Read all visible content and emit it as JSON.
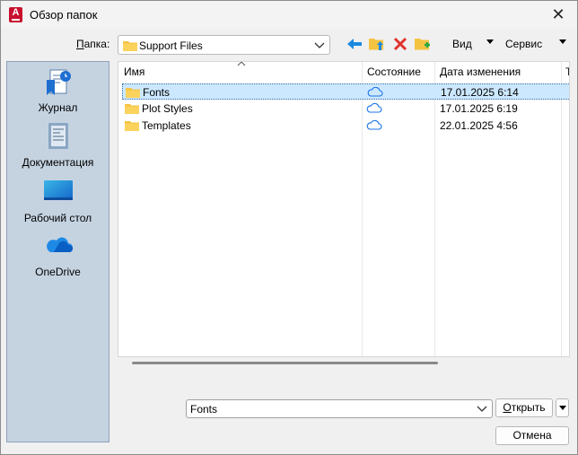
{
  "window": {
    "title": "Обзор папок",
    "close_glyph": "✕"
  },
  "toolbar": {
    "folder_label_accel": "П",
    "folder_label_rest": "апка:",
    "folder_value": "Support Files",
    "view_label": "Вид",
    "service_label": "Сервис",
    "icons": [
      "back-arrow-icon",
      "up-folder-icon",
      "delete-icon",
      "new-folder-icon"
    ]
  },
  "places": [
    {
      "label": "Журнал",
      "icon": "history-icon"
    },
    {
      "label": "Документация",
      "icon": "documents-icon"
    },
    {
      "label": "Рабочий стол",
      "icon": "desktop-icon"
    },
    {
      "label": "OneDrive",
      "icon": "onedrive-cloud-icon"
    }
  ],
  "columns": {
    "name": "Имя",
    "state": "Состояние",
    "date": "Дата изменения",
    "extra": "Т"
  },
  "files": [
    {
      "name": "Fonts",
      "date": "17.01.2025 6:14",
      "state_icon": "cloud-icon",
      "selected": true
    },
    {
      "name": "Plot Styles",
      "date": "17.01.2025 6:19",
      "state_icon": "cloud-icon",
      "selected": false
    },
    {
      "name": "Templates",
      "date": "22.01.2025 4:56",
      "state_icon": "cloud-icon",
      "selected": false
    }
  ],
  "bottom": {
    "filename_value": "Fonts",
    "open_accel": "О",
    "open_rest": "ткрыть",
    "cancel_label": "Отмена"
  },
  "colors": {
    "places_bg": "#c5d3e1",
    "selection": "#cce8ff",
    "accent_blue": "#1a73e8",
    "folder_yellow": "#f5c342",
    "delete_red": "#e0332e"
  }
}
